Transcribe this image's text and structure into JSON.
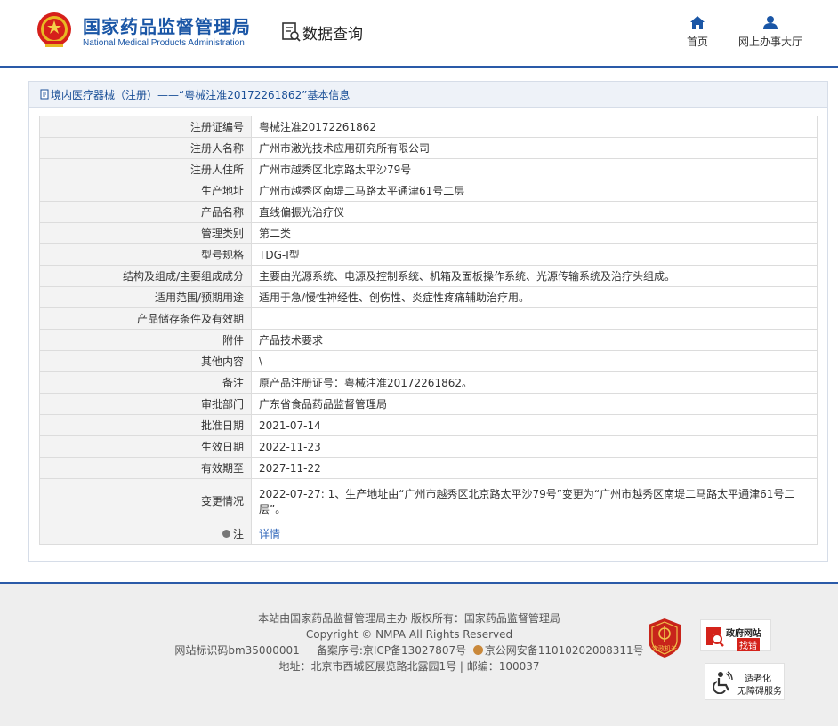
{
  "header": {
    "logo_cn": "国家药品监督管理局",
    "logo_en": "National Medical Products Administration",
    "page_title": "数据查询",
    "nav": [
      {
        "label": "首页",
        "icon": "home-icon"
      },
      {
        "label": "网上办事大厅",
        "icon": "user-icon"
      }
    ]
  },
  "panel": {
    "title": "境内医疗器械（注册）——“粤械注准20172261862”基本信息",
    "rows": [
      {
        "key": "注册证编号",
        "value": "粤械注准20172261862"
      },
      {
        "key": "注册人名称",
        "value": "广州市激光技术应用研究所有限公司"
      },
      {
        "key": "注册人住所",
        "value": "广州市越秀区北京路太平沙79号"
      },
      {
        "key": "生产地址",
        "value": "广州市越秀区南堤二马路太平通津61号二层"
      },
      {
        "key": "产品名称",
        "value": "直线偏振光治疗仪"
      },
      {
        "key": "管理类别",
        "value": "第二类"
      },
      {
        "key": "型号规格",
        "value": "TDG-Ⅰ型"
      },
      {
        "key": "结构及组成/主要组成成分",
        "value": "主要由光源系统、电源及控制系统、机箱及面板操作系统、光源传输系统及治疗头组成。"
      },
      {
        "key": "适用范围/预期用途",
        "value": "适用于急/慢性神经性、创伤性、炎症性疼痛辅助治疗用。"
      },
      {
        "key": "产品储存条件及有效期",
        "value": ""
      },
      {
        "key": "附件",
        "value": "产品技术要求"
      },
      {
        "key": "其他内容",
        "value": "\\"
      },
      {
        "key": "备注",
        "value": "原产品注册证号：粤械注准20172261862。"
      },
      {
        "key": "审批部门",
        "value": "广东省食品药品监督管理局"
      },
      {
        "key": "批准日期",
        "value": "2021-07-14"
      },
      {
        "key": "生效日期",
        "value": "2022-11-23"
      },
      {
        "key": "有效期至",
        "value": "2027-11-22"
      },
      {
        "key": "变更情况",
        "value": "2022-07-27: 1、生产地址由“广州市越秀区北京路太平沙79号”变更为“广州市越秀区南堤二马路太平通津61号二层”。"
      }
    ],
    "note_key": "注",
    "note_link": "详情"
  },
  "footer": {
    "line1": "本站由国家药品监督管理局主办 版权所有：国家药品监督管理局",
    "line2": "Copyright © NMPA All Rights Reserved",
    "line3a": "网站标识码bm35000001",
    "line3b": "备案序号:京ICP备13027807号",
    "line3c": "京公网安备11010202008311号",
    "line4": "地址：北京市西城区展览路北露园1号 | 邮编：100037",
    "badge_party": "党政机关",
    "badge_zhaocuo_1": "政府网站",
    "badge_zhaocuo_2": "找错",
    "badge_access_1": "适老化",
    "badge_access_2": "无障碍服务"
  },
  "colors": {
    "brand_blue": "#1a56a6",
    "link_blue": "#2a62b8",
    "border_blue": "#2a5aa8",
    "party_red": "#c8241b"
  }
}
